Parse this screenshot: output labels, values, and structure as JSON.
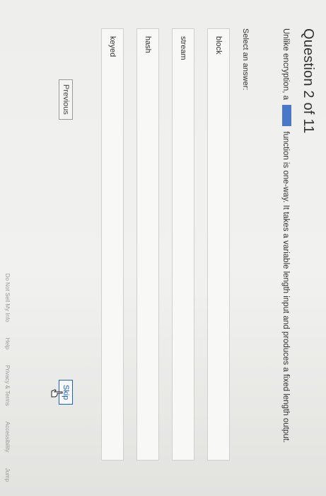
{
  "quiz": {
    "title": "Question 2 of 11",
    "question_before": "Unlike encryption, a",
    "question_after": "function is one-way. It takes a variable length input and produces a fixed length output.",
    "prompt": "Select an answer:"
  },
  "answers": [
    {
      "label": "block"
    },
    {
      "label": "stream"
    },
    {
      "label": "hash"
    },
    {
      "label": "keyed"
    }
  ],
  "navigation": {
    "previous_label": "Previous",
    "skip_label": "Skip"
  },
  "footer": {
    "links": [
      "Do Not Sell My Info",
      "Help",
      "Privacy & Terms",
      "Accessibility",
      "Jump"
    ]
  },
  "icons": {
    "cursor": "hand-cursor-icon"
  }
}
